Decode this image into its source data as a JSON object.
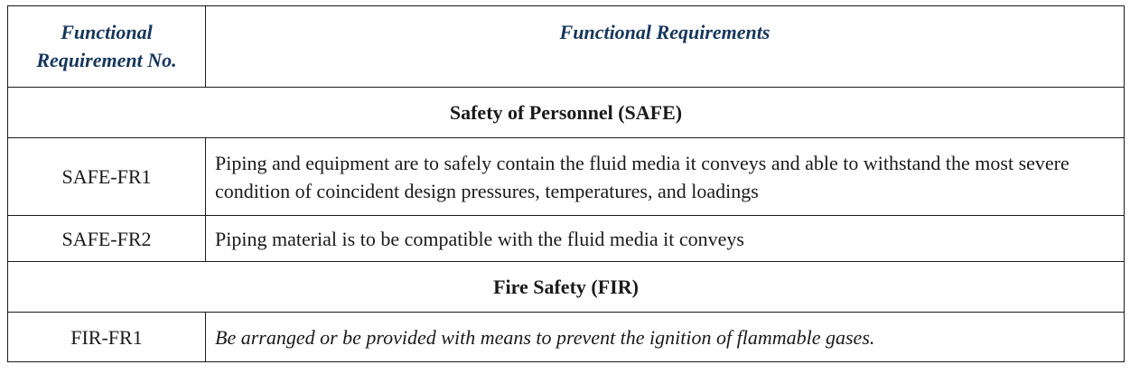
{
  "table": {
    "headers": {
      "col1": "Functional Requirement No.",
      "col2": "Functional Requirements"
    },
    "sections": [
      {
        "title": "Safety of Personnel (SAFE)",
        "rows": [
          {
            "id": "SAFE-FR1",
            "text": "Piping and equipment are to safely contain the fluid media it conveys and able to withstand the most severe condition of coincident design pressures, temperatures, and loadings"
          },
          {
            "id": "SAFE-FR2",
            "text": "Piping material is to be compatible with the fluid media it conveys"
          }
        ]
      },
      {
        "title": "Fire Safety (FIR)",
        "rows": [
          {
            "id": "FIR-FR1",
            "text": "Be arranged or be provided with means to prevent the ignition of flammable gases."
          }
        ]
      }
    ]
  }
}
